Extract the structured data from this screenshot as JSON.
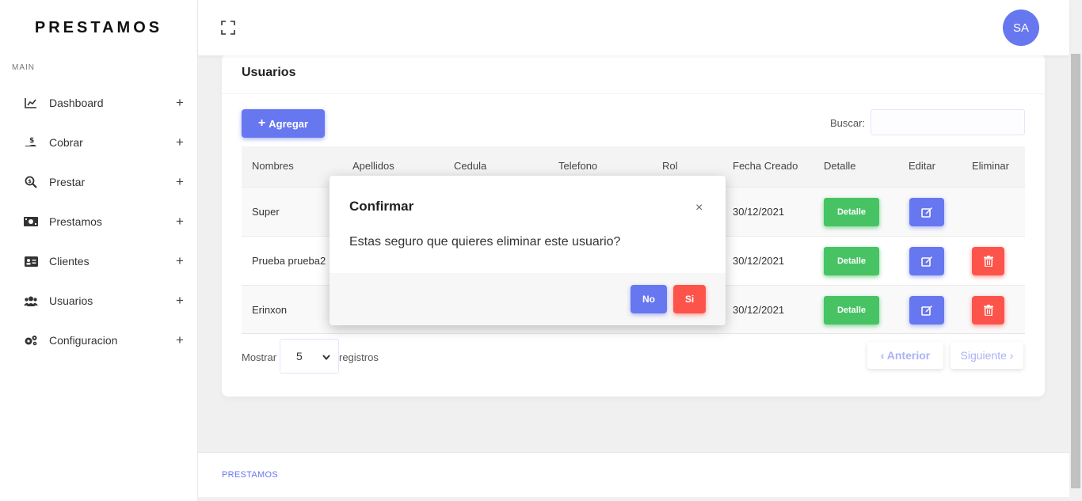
{
  "app": {
    "brand": "PRESTAMOS",
    "section_label": "MAIN",
    "user_initials": "SA",
    "footer_text": "PRESTAMOS"
  },
  "sidebar": {
    "items": [
      {
        "label": "Dashboard",
        "icon": "chart-line-icon",
        "expand": "+"
      },
      {
        "label": "Cobrar",
        "icon": "hand-dollar-icon",
        "expand": "+"
      },
      {
        "label": "Prestar",
        "icon": "search-dollar-icon",
        "expand": "+"
      },
      {
        "label": "Prestamos",
        "icon": "money-bill-icon",
        "expand": "+"
      },
      {
        "label": "Clientes",
        "icon": "id-card-icon",
        "expand": "+"
      },
      {
        "label": "Usuarios",
        "icon": "users-icon",
        "expand": "+"
      },
      {
        "label": "Configuracion",
        "icon": "cogs-icon",
        "expand": "+"
      }
    ]
  },
  "card": {
    "title": "Usuarios",
    "add_button": "Agregar",
    "add_icon": "+",
    "search_label": "Buscar:",
    "search_value": ""
  },
  "table": {
    "headers": [
      "Nombres",
      "Apellidos",
      "Cedula",
      "Telefono",
      "Rol",
      "Fecha Creado",
      "Detalle",
      "Editar",
      "Eliminar"
    ],
    "rows": [
      {
        "nombres": "Super",
        "fecha": "30/12/2021",
        "detalle": "Detalle",
        "has_delete": false
      },
      {
        "nombres": "Prueba prueba2",
        "fecha": "30/12/2021",
        "detalle": "Detalle",
        "has_delete": true
      },
      {
        "nombres": "Erinxon",
        "fecha": "30/12/2021",
        "detalle": "Detalle",
        "has_delete": true
      }
    ]
  },
  "pagination": {
    "show_label": "Mostrar",
    "page_size": "5",
    "records_label": "registros",
    "prev": "Anterior",
    "next": "Siguiente"
  },
  "modal": {
    "title": "Confirmar",
    "close": "×",
    "message": "Estas seguro que quieres eliminar este usuario?",
    "no": "No",
    "yes": "Si"
  },
  "colors": {
    "primary": "#6777ef",
    "success": "#47c363",
    "danger": "#fc544b"
  }
}
